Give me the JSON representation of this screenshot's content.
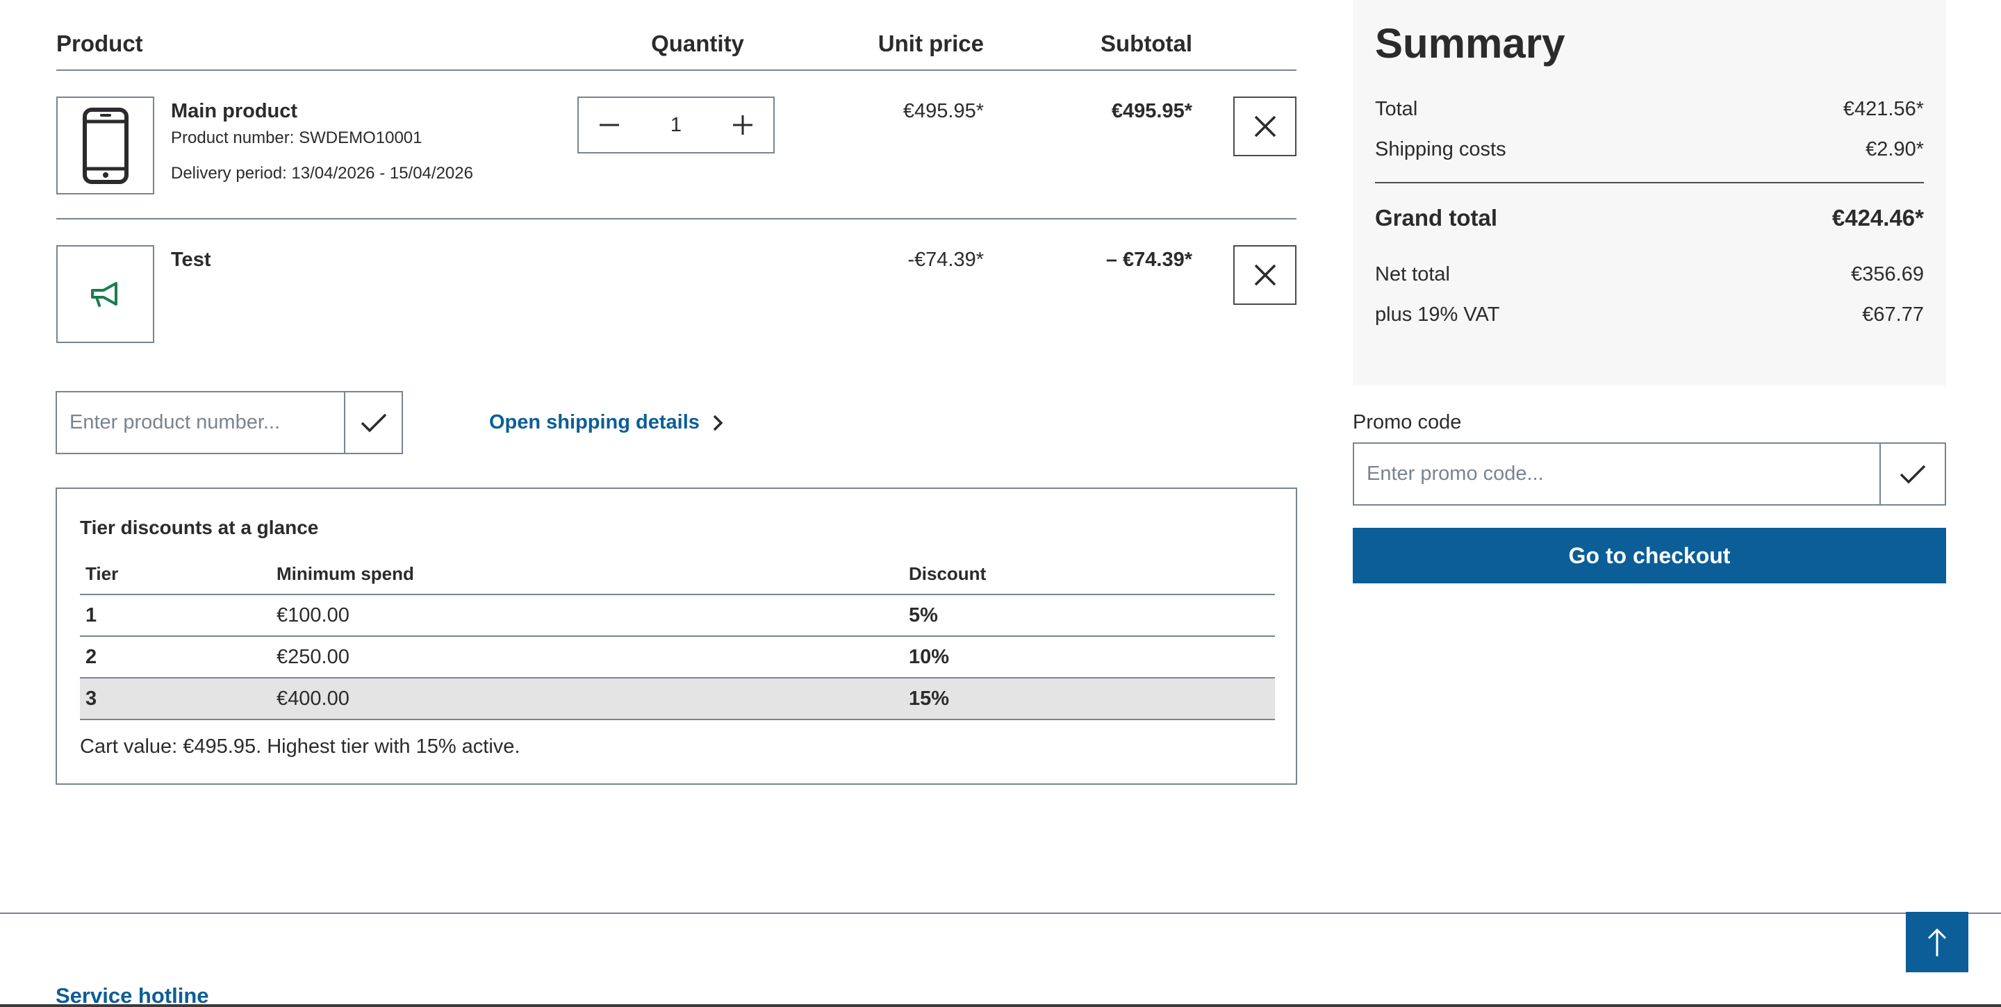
{
  "cart": {
    "headers": {
      "product": "Product",
      "quantity": "Quantity",
      "unit_price": "Unit price",
      "subtotal": "Subtotal"
    },
    "items": [
      {
        "name": "Main product",
        "product_number": "Product number: SWDEMO10001",
        "delivery": "Delivery period: 13/04/2026 - 15/04/2026",
        "quantity": "1",
        "unit_price": "€495.95*",
        "subtotal": "€495.95*",
        "icon": "smartphone-icon"
      },
      {
        "name": "Test",
        "unit_price": "-€74.39*",
        "subtotal": "– €74.39*",
        "icon": "megaphone-icon"
      }
    ]
  },
  "add_product": {
    "placeholder": "Enter product number..."
  },
  "shipping_link": "Open shipping details",
  "tiers": {
    "title": "Tier discounts at a glance",
    "columns": [
      "Tier",
      "Minimum spend",
      "Discount"
    ],
    "rows": [
      {
        "tier": "1",
        "min": "€100.00",
        "discount": "5%"
      },
      {
        "tier": "2",
        "min": "€250.00",
        "discount": "10%"
      },
      {
        "tier": "3",
        "min": "€400.00",
        "discount": "15%"
      }
    ],
    "active_tier": "3",
    "note": "Cart value: €495.95. Highest tier with 15% active."
  },
  "summary": {
    "title": "Summary",
    "total_label": "Total",
    "total_value": "€421.56*",
    "shipping_label": "Shipping costs",
    "shipping_value": "€2.90*",
    "grand_label": "Grand total",
    "grand_value": "€424.46*",
    "net_label": "Net total",
    "net_value": "€356.69",
    "vat_label": "plus 19% VAT",
    "vat_value": "€67.77"
  },
  "promo": {
    "label": "Promo code",
    "placeholder": "Enter promo code..."
  },
  "checkout_label": "Go to checkout",
  "footer": {
    "hotline": "Service hotline"
  },
  "colors": {
    "accent": "#0b5e97",
    "border": "#798490",
    "summary_bg": "#f7f7f7",
    "active_row": "#e4e4e4",
    "megaphone": "#1a7d4f"
  }
}
